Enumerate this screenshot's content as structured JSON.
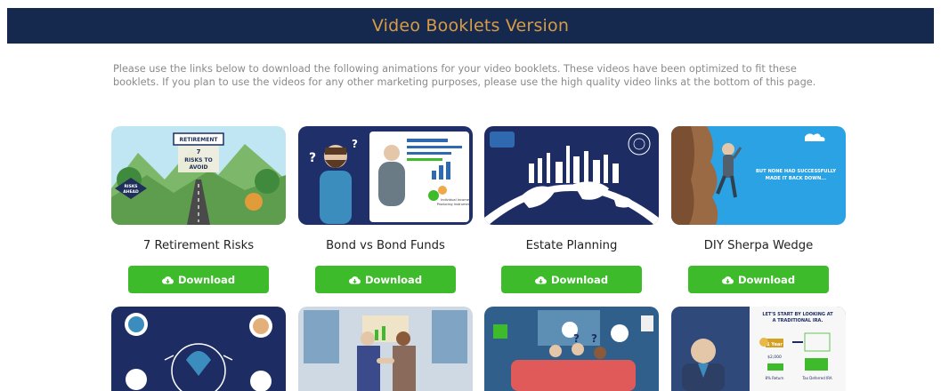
{
  "header": {
    "title": "Video Booklets Version"
  },
  "intro": {
    "text": "Please use the links below to download the following animations for your video booklets. These videos have been optimized to fit these booklets. If you plan to use the videos for any other marketing purposes, please use the high quality video links at the bottom of this page."
  },
  "videos": [
    {
      "title": "7 Retirement Risks",
      "download_label": "Download",
      "thumb_text": {
        "sign_top": "RETIREMENT",
        "sign_main": "7\nRISKS TO\nAVOID",
        "sign_side": "RISKS\nAHEAD"
      }
    },
    {
      "title": "Bond vs Bond Funds",
      "download_label": "Download",
      "thumb_text": {
        "caption": "Individual Income Producing Instruments"
      }
    },
    {
      "title": "Estate Planning",
      "download_label": "Download"
    },
    {
      "title": "DIY Sherpa Wedge",
      "download_label": "Download",
      "thumb_text": {
        "caption": "BUT NONE HAD SUCCESSFULLY MADE IT BACK DOWN..."
      }
    }
  ],
  "videos_row2": [
    {
      "thumb": "lightbulb-people"
    },
    {
      "thumb": "handshake-office"
    },
    {
      "thumb": "family-couch"
    },
    {
      "thumb": "traditional-ira",
      "thumb_text": {
        "headline": "LET'S START BY LOOKING AT A TRADITIONAL IRA.",
        "year": "1 Year",
        "amount": "$2,000",
        "left_label": "8% Return",
        "right_label": "Tax Deferred IRA"
      }
    }
  ],
  "colors": {
    "banner": "#15294f",
    "banner_text": "#d99b44",
    "button": "#3dbb2a"
  },
  "icons": {
    "download": "cloud-download-icon"
  }
}
